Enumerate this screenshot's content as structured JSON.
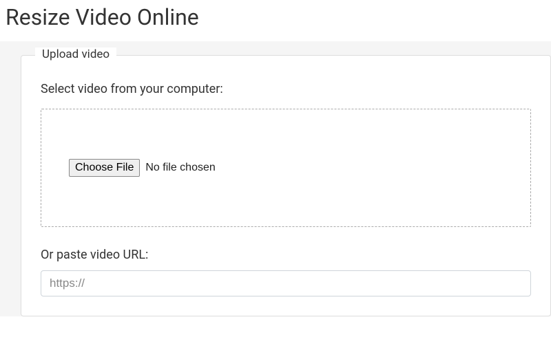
{
  "page": {
    "title": "Resize Video Online"
  },
  "upload": {
    "legend": "Upload video",
    "select_label": "Select video from your computer:",
    "choose_button": "Choose File",
    "file_status": "No file chosen",
    "url_label": "Or paste video URL:",
    "url_placeholder": "https://"
  }
}
